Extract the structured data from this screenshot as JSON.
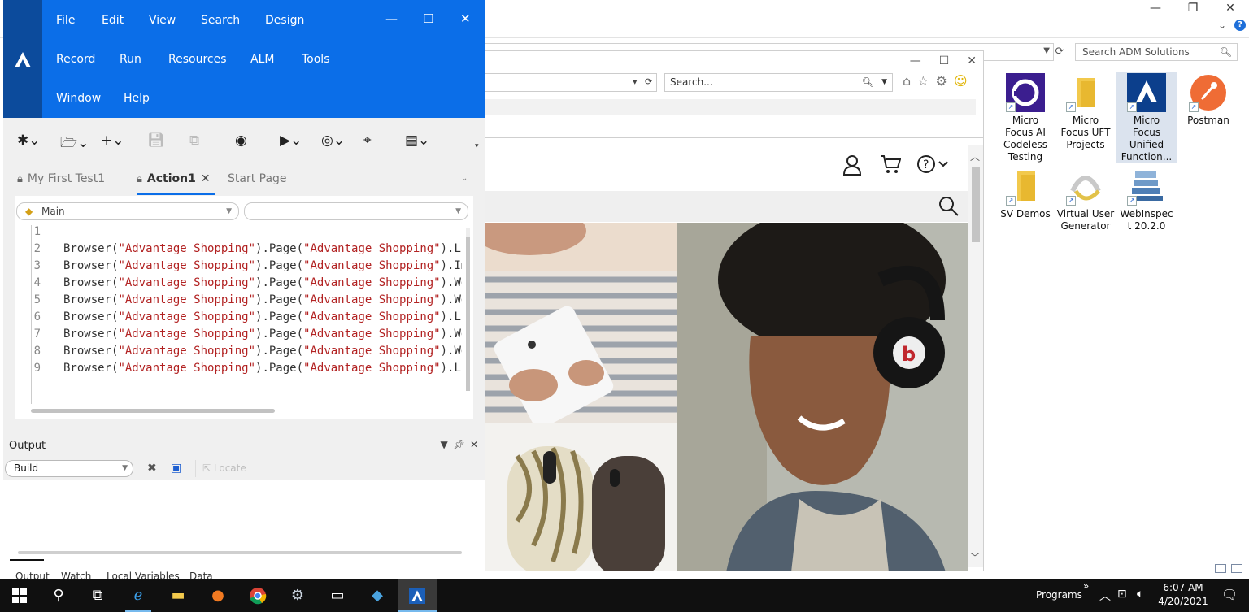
{
  "explorer": {
    "search_placeholder": "Search ADM Solutions",
    "help_label": "?"
  },
  "desktop_icons": [
    {
      "label": "Micro Focus AI Codeless Testing",
      "lines": [
        "Micro",
        "Focus AI",
        "Codeless",
        "Testing"
      ]
    },
    {
      "label": "Micro Focus UFT Projects",
      "lines": [
        "Micro",
        "Focus UFT",
        "Projects"
      ]
    },
    {
      "label": "Micro Focus Unified Function...",
      "lines": [
        "Micro",
        "Focus",
        "Unified",
        "Function..."
      ]
    },
    {
      "label": "Postman",
      "lines": [
        "Postman"
      ]
    },
    {
      "label": "SV Demos",
      "lines": [
        "SV Demos"
      ]
    },
    {
      "label": "Virtual User Generator",
      "lines": [
        "Virtual User",
        "Generator"
      ]
    },
    {
      "label": "WebInspect 20.2.0",
      "lines": [
        "WebInspec",
        "t 20.2.0"
      ]
    }
  ],
  "browser": {
    "search_placeholder": "Search..."
  },
  "uft": {
    "menus": [
      "File",
      "Edit",
      "View",
      "Search",
      "Design",
      "Record",
      "Run",
      "Resources",
      "ALM",
      "Tools",
      "Window",
      "Help"
    ],
    "tabs": [
      {
        "label": "My First Test1",
        "locked": true,
        "active": false
      },
      {
        "label": "Action1",
        "locked": true,
        "active": true
      },
      {
        "label": "Start Page",
        "locked": false,
        "active": false
      }
    ],
    "scope_selector": "Main",
    "object_selector": "",
    "code_lines": [
      {
        "n": "1",
        "code": ""
      },
      {
        "n": "2",
        "code": "Browser(\"Advantage Shopping\").Page(\"Advantage Shopping\").Link(\"S"
      },
      {
        "n": "3",
        "code": "Browser(\"Advantage Shopping\").Page(\"Advantage Shopping\").Image("
      },
      {
        "n": "4",
        "code": "Browser(\"Advantage Shopping\").Page(\"Advantage Shopping\").WebEle"
      },
      {
        "n": "5",
        "code": "Browser(\"Advantage Shopping\").Page(\"Advantage Shopping\").WebBu"
      },
      {
        "n": "6",
        "code": "Browser(\"Advantage Shopping\").Page(\"Advantage Shopping\").Link(\"S"
      },
      {
        "n": "7",
        "code": "Browser(\"Advantage Shopping\").Page(\"Advantage Shopping\").WebEle"
      },
      {
        "n": "8",
        "code": "Browser(\"Advantage Shopping\").Page(\"Advantage Shopping\").WebEle"
      },
      {
        "n": "9",
        "code": "Browser(\"Advantage Shopping\").Page(\"Advantage Shopping\").Link(\"H"
      }
    ],
    "output": {
      "title": "Output",
      "build_selector": "Build",
      "locate_label": "Locate",
      "tabs": [
        "Output",
        "Watch",
        "Local Variables",
        "Data"
      ]
    }
  },
  "taskbar": {
    "programs_label": "Programs",
    "overflow": "»",
    "time": "6:07 AM",
    "date": "4/20/2021"
  },
  "colors": {
    "uft_menu_blue": "#0b6ee8",
    "uft_logo_strip": "#0c4b9c",
    "taskbar_bg": "#101010",
    "string_red": "#b22222"
  }
}
